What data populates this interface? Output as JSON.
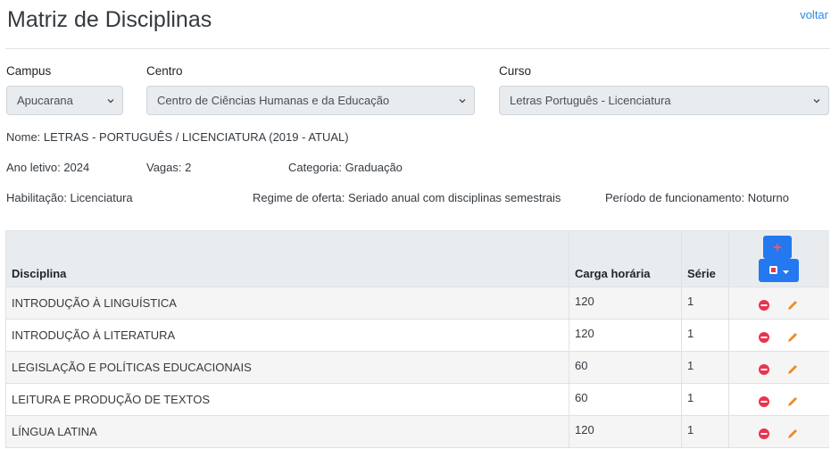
{
  "page": {
    "title": "Matriz de Disciplinas",
    "back_link": "voltar"
  },
  "filters": {
    "campus": {
      "label": "Campus",
      "value": "Apucarana"
    },
    "centro": {
      "label": "Centro",
      "value": "Centro de Ciências Humanas e da Educação"
    },
    "curso": {
      "label": "Curso",
      "value": "Letras Português - Licenciatura"
    }
  },
  "info": {
    "nome": "Nome: LETRAS - PORTUGUÊS / LICENCIATURA (2019 - ATUAL)",
    "ano_letivo": "Ano letivo: 2024",
    "vagas": "Vagas: 2",
    "categoria": "Categoria: Graduação",
    "habilitacao": "Habilitação: Licenciatura",
    "regime": "Regime de oferta: Seriado anual com disciplinas semestrais",
    "periodo": "Período de funcionamento: Noturno"
  },
  "table": {
    "headers": [
      "Disciplina",
      "Carga horária",
      "Série"
    ],
    "rows": [
      {
        "disciplina": "INTRODUÇÃO À LINGUÍSTICA",
        "carga": "120",
        "serie": "1"
      },
      {
        "disciplina": "INTRODUÇÃO À LITERATURA",
        "carga": "120",
        "serie": "1"
      },
      {
        "disciplina": "LEGISLAÇÃO E POLÍTICAS EDUCACIONAIS",
        "carga": "60",
        "serie": "1"
      },
      {
        "disciplina": "LEITURA E PRODUÇÃO DE TEXTOS",
        "carga": "60",
        "serie": "1"
      },
      {
        "disciplina": "LÍNGUA LATINA",
        "carga": "120",
        "serie": "1"
      }
    ]
  },
  "icons": {
    "add": "plus-icon",
    "export": "file-export-icon",
    "dropdown": "caret-down-icon",
    "remove": "minus-circle-icon",
    "edit": "pencil-icon"
  },
  "colors": {
    "primary": "#2478f0",
    "link": "#2b8ae6",
    "danger": "#e8344f",
    "edit": "#f08a24",
    "header_bg": "#e9ecef"
  }
}
